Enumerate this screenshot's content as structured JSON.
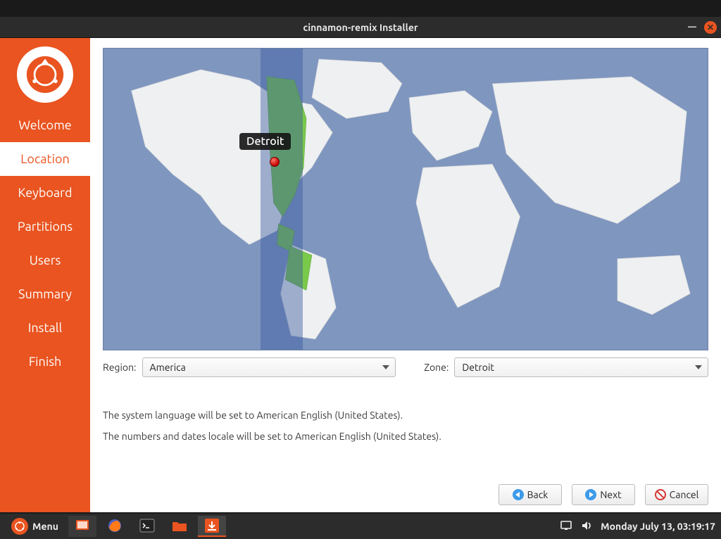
{
  "window": {
    "title": "cinnamon-remix Installer"
  },
  "sidebar": {
    "items": [
      "Welcome",
      "Location",
      "Keyboard",
      "Partitions",
      "Users",
      "Summary",
      "Install",
      "Finish"
    ],
    "active_index": 1
  },
  "map": {
    "selected_city": "Detroit"
  },
  "region": {
    "label": "Region:",
    "value": "America",
    "zone_label": "Zone:",
    "zone_value": "Detroit"
  },
  "locale_info": {
    "language_text": "The system language will be set to American English (United States).",
    "numbers_text": "The numbers and dates locale will be set to American English (United States)."
  },
  "buttons": {
    "back": "Back",
    "next": "Next",
    "cancel": "Cancel"
  },
  "taskbar": {
    "menu_label": "Menu",
    "clock": "Monday July 13, 03:19:17"
  }
}
